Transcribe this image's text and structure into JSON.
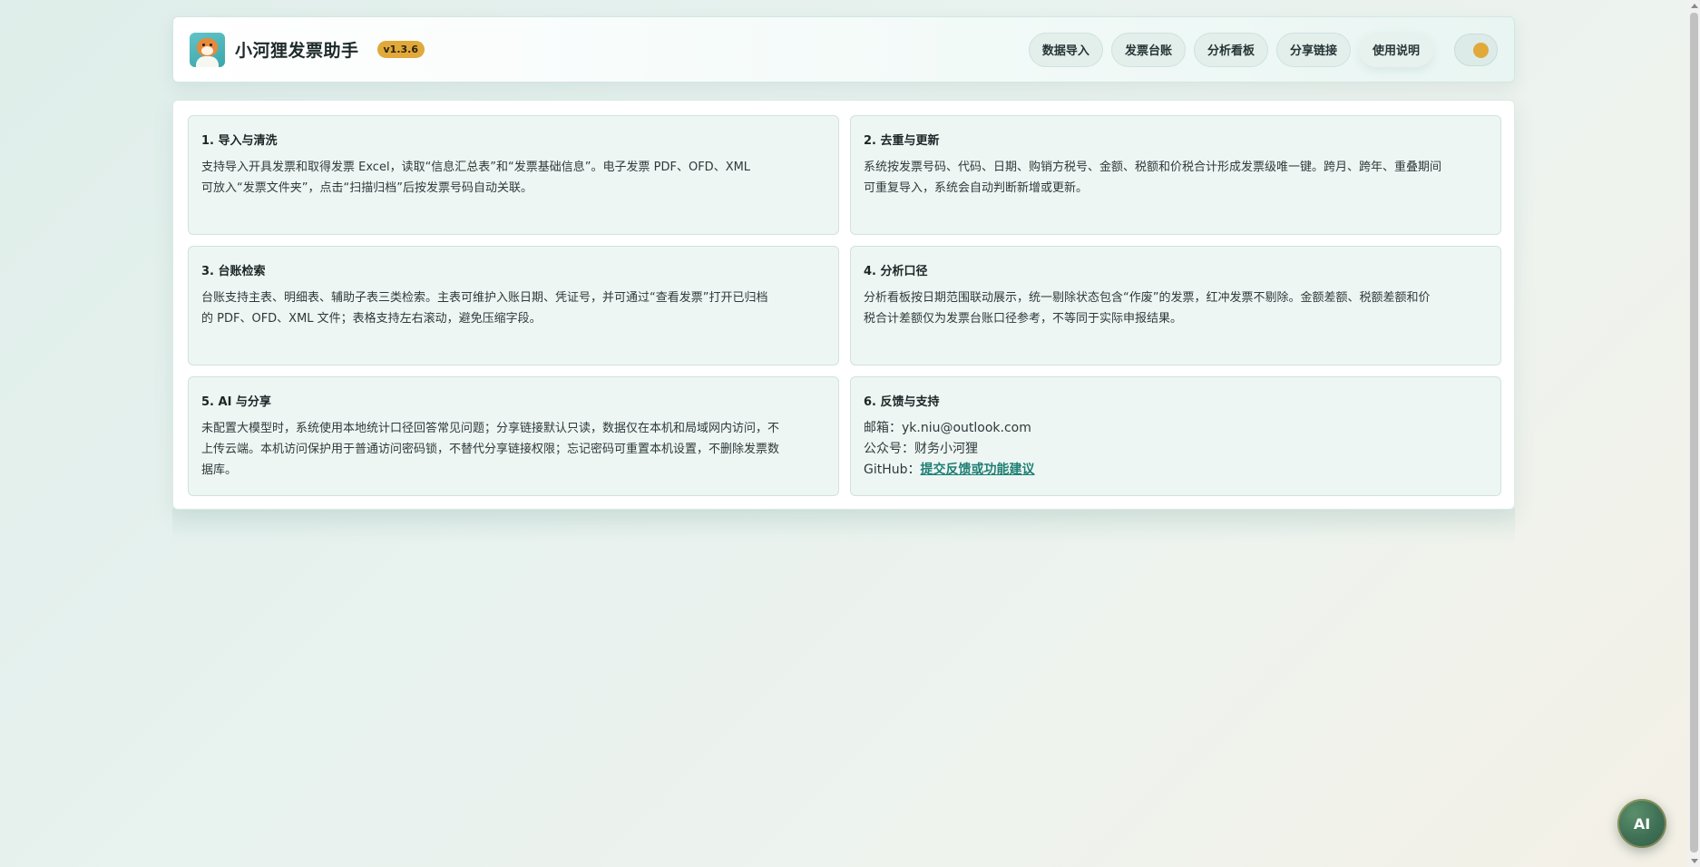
{
  "header": {
    "title": "小河狸发票助手",
    "version": "v1.3.6",
    "logo_icon": "beaver-mascot-icon"
  },
  "nav": {
    "items": [
      {
        "label": "数据导入"
      },
      {
        "label": "发票台账"
      },
      {
        "label": "分析看板"
      },
      {
        "label": "分享链接"
      },
      {
        "label": "使用说明"
      }
    ],
    "theme_toggle_icon": "theme-toggle-icon"
  },
  "cards": [
    {
      "title": "1. 导入与清洗",
      "lines": [
        "支持导入开具发票和取得发票 Excel，读取“信息汇总表”和“发票基础信息”。电子发票 PDF、OFD、XML",
        "可放入“发票文件夹”，点击“扫描归档”后按发票号码自动关联。"
      ]
    },
    {
      "title": "2. 去重与更新",
      "lines": [
        "系统按发票号码、代码、日期、购销方税号、金额、税额和价税合计形成发票级唯一键。跨月、跨年、重叠期间",
        "可重复导入，系统会自动判断新增或更新。"
      ]
    },
    {
      "title": "3. 台账检索",
      "lines": [
        "台账支持主表、明细表、辅助子表三类检索。主表可维护入账日期、凭证号，并可通过“查看发票”打开已归档",
        "的 PDF、OFD、XML 文件；表格支持左右滚动，避免压缩字段。"
      ]
    },
    {
      "title": "4. 分析口径",
      "lines": [
        "分析看板按日期范围联动展示，统一剔除状态包含“作废”的发票，红冲发票不剔除。金额差额、税额差额和价",
        "税合计差额仅为发票台账口径参考，不等同于实际申报结果。"
      ]
    },
    {
      "title": "5. AI 与分享",
      "lines": [
        "未配置大模型时，系统使用本地统计口径回答常见问题；分享链接默认只读，数据仅在本机和局域网内访问，不",
        "上传云端。本机访问保护用于普通访问密码锁，不替代分享链接权限；忘记密码可重置本机设置，不删除发票数",
        "据库。"
      ]
    },
    {
      "title": "6. 反馈与支持",
      "email": "邮箱：yk.niu@outlook.com",
      "wechat": "公众号：财务小河狸",
      "github_prefix": "GitHub：",
      "github_link": "提交反馈或功能建议"
    }
  ],
  "ai_button": {
    "label": "AI"
  },
  "colors": {
    "accent": "#e0a93a",
    "teal": "#1f7f74",
    "card_bg": "#eef6f3"
  }
}
